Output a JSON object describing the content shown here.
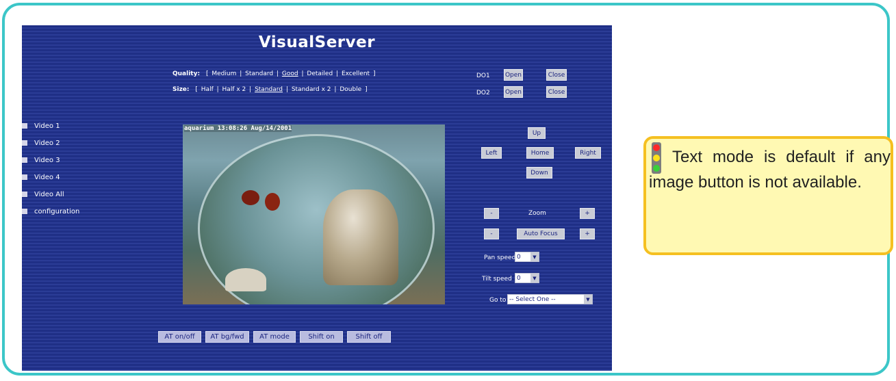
{
  "app": {
    "title": "VisualServer"
  },
  "quality": {
    "label": "Quality:",
    "options": [
      "Medium",
      "Standard",
      "Good",
      "Detailed",
      "Excellent"
    ],
    "selected": "Good"
  },
  "size": {
    "label": "Size:",
    "options": [
      "Half",
      "Half x 2",
      "Standard",
      "Standard x 2",
      "Double"
    ],
    "selected": "Standard"
  },
  "digital_out": [
    {
      "label": "DO1",
      "open": "Open",
      "close": "Close"
    },
    {
      "label": "DO2",
      "open": "Open",
      "close": "Close"
    }
  ],
  "menu": {
    "items": [
      "Video 1",
      "Video 2",
      "Video 3",
      "Video 4",
      "Video All",
      "configuration"
    ]
  },
  "video": {
    "timestamp": "aquarium 13:08:26 Aug/14/2001"
  },
  "ptz": {
    "up": "Up",
    "left": "Left",
    "home": "Home",
    "right": "Right",
    "down": "Down",
    "zoom_minus": "-",
    "zoom_label": "Zoom",
    "zoom_plus": "+",
    "focus_minus": "-",
    "focus_label": "Auto Focus",
    "focus_plus": "+",
    "pan_speed_label": "Pan speed",
    "pan_speed_value": "0",
    "tilt_speed_label": "Tilt speed",
    "tilt_speed_value": "0",
    "goto_label": "Go to",
    "goto_value": "-- Select One --"
  },
  "bottom_buttons": [
    "AT on/off",
    "AT bg/fwd",
    "AT mode",
    "Shift on",
    "Shift off"
  ],
  "note": {
    "text": "Text mode is default if any image button is not available."
  },
  "colors": {
    "frame": "#3cc6c8",
    "panel": "#1f2f86",
    "note_border": "#f5c021",
    "note_bg": "#fff9b3"
  }
}
